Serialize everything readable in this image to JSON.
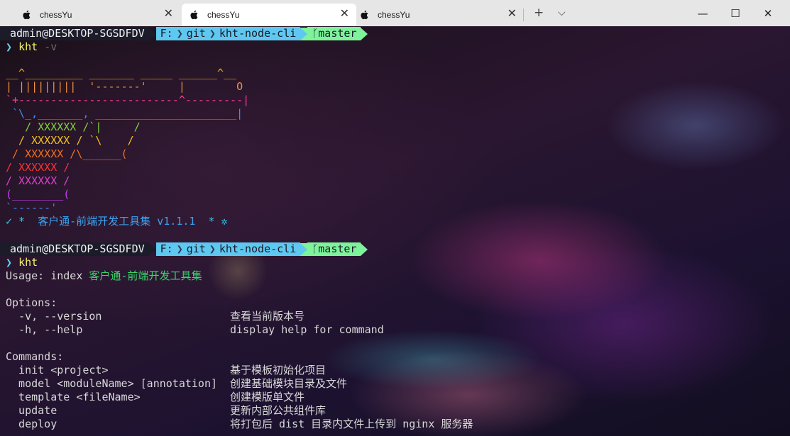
{
  "tabs": [
    {
      "title": "chessYu",
      "icon": "apple-icon",
      "active": false
    },
    {
      "title": "chessYu",
      "icon": "apple-icon",
      "active": true
    },
    {
      "title": "chessYu",
      "icon": "apple-icon",
      "active": false
    }
  ],
  "tabbar": {
    "new_tab": "+",
    "dropdown": "⌵"
  },
  "window_controls": {
    "minimize": "—",
    "maximize": "☐",
    "close": "✕"
  },
  "prompt": {
    "user": "admin@DESKTOP-SGSDFDV",
    "drive": "F:",
    "dir1": "git",
    "dir2": "kht-node-cli",
    "branch": "master"
  },
  "command1": {
    "caret": "❯",
    "cmd": "kht",
    "args": "-v"
  },
  "ascii_art": [
    {
      "text": "__^_________ _______ _____ ______^__",
      "color": "#f0b020"
    },
    {
      "text": "| |||||||||  '-------'     |        O",
      "color": "#f09040"
    },
    {
      "text": "`+-------------------------^---------|",
      "color": "#ff3aa0"
    },
    {
      "text": " `\\_,_______, ______________________|",
      "color": "#3a8ff0"
    },
    {
      "text": "   / XXXXXX /`|     /",
      "color": "#7fd33a"
    },
    {
      "text": "  / XXXXXX / `\\    /",
      "color": "#f0c020"
    },
    {
      "text": " / XXXXXX /\\______(",
      "color": "#f07020"
    },
    {
      "text": "/ XXXXXX /",
      "color": "#ff3030"
    },
    {
      "text": "/ XXXXXX /",
      "color": "#e040d0"
    },
    {
      "text": "(________(",
      "color": "#c040f0"
    },
    {
      "text": "`------'",
      "color": "#4a7ff0"
    }
  ],
  "banner": {
    "prefix": "✓ *  ",
    "title": "客户通-前端开发工具集 v1.1.1",
    "suffix": "  * ✲"
  },
  "command2": {
    "caret": "❯",
    "cmd": "kht"
  },
  "usage": {
    "label": "Usage: index ",
    "name": "客户通-前端开发工具集"
  },
  "options_header": "Options:",
  "options": [
    {
      "flag": "  -v, --version",
      "desc": "查看当前版本号"
    },
    {
      "flag": "  -h, --help",
      "desc": "display help for command"
    }
  ],
  "commands_header": "Commands:",
  "commands": [
    {
      "name": "  init <project>",
      "desc": "基于模板初始化项目"
    },
    {
      "name": "  model <moduleName> [annotation]",
      "desc": "创建基础模块目录及文件"
    },
    {
      "name": "  template <fileName>",
      "desc": "创建模版单文件"
    },
    {
      "name": "  update",
      "desc": "更新内部公共组件库"
    },
    {
      "name": "  deploy",
      "desc": "将打包后 dist 目录内文件上传到 nginx 服务器"
    }
  ]
}
